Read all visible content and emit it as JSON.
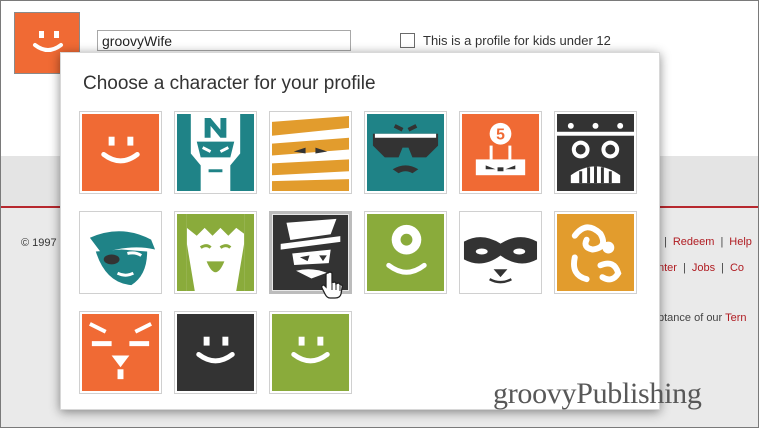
{
  "profile": {
    "name_value": "groovyWife",
    "kids_label": "This is a profile for kids under 12",
    "kids_checked": false,
    "avatar_color": "#f06a34"
  },
  "picker": {
    "title": "Choose a character for your profile",
    "selected_index": 8,
    "characters": [
      {
        "icon": "orange-smiley-icon",
        "color": "#f06a34"
      },
      {
        "icon": "teal-masked-hero-icon",
        "color": "#1f8387"
      },
      {
        "icon": "yellow-mummy-icon",
        "color": "#e29c2d"
      },
      {
        "icon": "teal-sunglasses-face-icon",
        "color": "#1f8387"
      },
      {
        "icon": "orange-robot-5-icon",
        "color": "#f06a34"
      },
      {
        "icon": "black-robot-icon",
        "color": "#333333"
      },
      {
        "icon": "teal-pirate-girl-icon",
        "color": "#1f8387"
      },
      {
        "icon": "green-monster-face-icon",
        "color": "#8aab3b"
      },
      {
        "icon": "dark-bandit-hat-icon",
        "color": "#333333"
      },
      {
        "icon": "green-cyclops-icon",
        "color": "#8aab3b"
      },
      {
        "icon": "raccoon-mask-icon",
        "color": "#ffffff"
      },
      {
        "icon": "yellow-swirl-face-icon",
        "color": "#e29c2d"
      },
      {
        "icon": "orange-sleepy-bird-icon",
        "color": "#f06a34"
      },
      {
        "icon": "black-smiley-icon",
        "color": "#333333"
      },
      {
        "icon": "green-smiley-icon",
        "color": "#8aab3b"
      }
    ]
  },
  "footer": {
    "copyright": "© 1997",
    "links_row1": [
      "Redeem",
      "Help"
    ],
    "links_row1_trailing": "|",
    "links_row2": [
      "nter",
      "Jobs",
      "Co"
    ],
    "terms_prefix": "ptance of our",
    "terms_link": "Tern"
  },
  "watermark": "groovyPublishing",
  "colors": {
    "accent_red": "#b7282e",
    "orange": "#f06a34",
    "teal": "#1f8387",
    "green": "#8aab3b",
    "yellow": "#e29c2d",
    "dark": "#333333"
  }
}
